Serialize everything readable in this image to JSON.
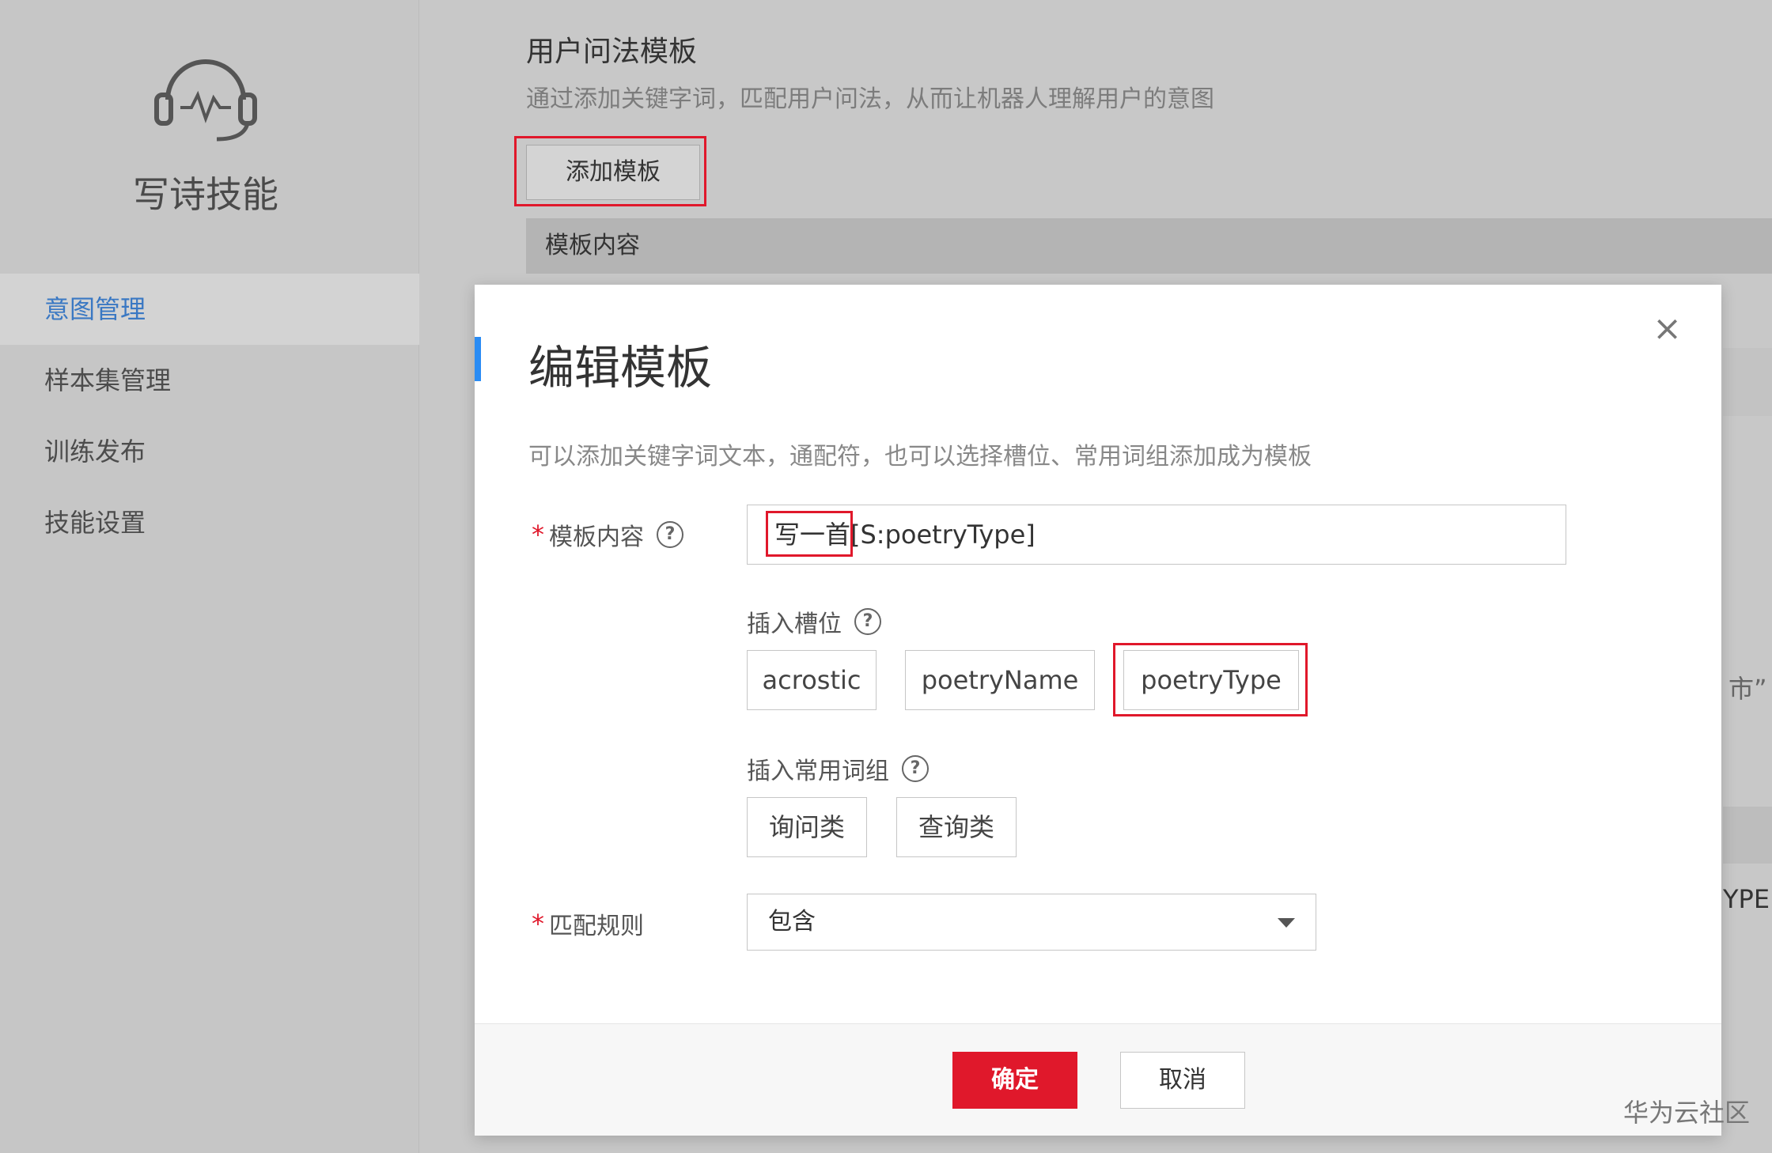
{
  "sidebar": {
    "skill_name": "写诗技能",
    "nav_items": [
      {
        "label": "意图管理",
        "active": true
      },
      {
        "label": "样本集管理",
        "active": false
      },
      {
        "label": "训练发布",
        "active": false
      },
      {
        "label": "技能设置",
        "active": false
      }
    ]
  },
  "background_page": {
    "title": "用户问法模板",
    "subtitle": "通过添加关键字词，匹配用户问法，从而让机器人理解用户的意图",
    "add_button": "添加模板",
    "table_header": "模板内容",
    "fragment_1": "市”",
    "fragment_2": "YPE"
  },
  "modal": {
    "title": "编辑模板",
    "close_symbol": "×",
    "description": "可以添加关键字词文本，通配符，也可以选择槽位、常用词组添加成为模板",
    "template_label": "模板内容",
    "template_value": "写一首[S:poetryType]",
    "slot_label": "插入槽位",
    "slots": [
      "acrostic",
      "poetryName",
      "poetryType"
    ],
    "phrase_label": "插入常用词组",
    "phrases": [
      "询问类",
      "查询类"
    ],
    "match_label": "匹配规则",
    "match_value": "包含",
    "confirm": "确定",
    "cancel": "取消",
    "required_mark": "*",
    "help_mark": "?"
  },
  "watermark": "华为云社区",
  "colors": {
    "accent_blue": "#2a8cf4",
    "primary_red": "#e0182b",
    "nav_active": "#3a78c3"
  }
}
